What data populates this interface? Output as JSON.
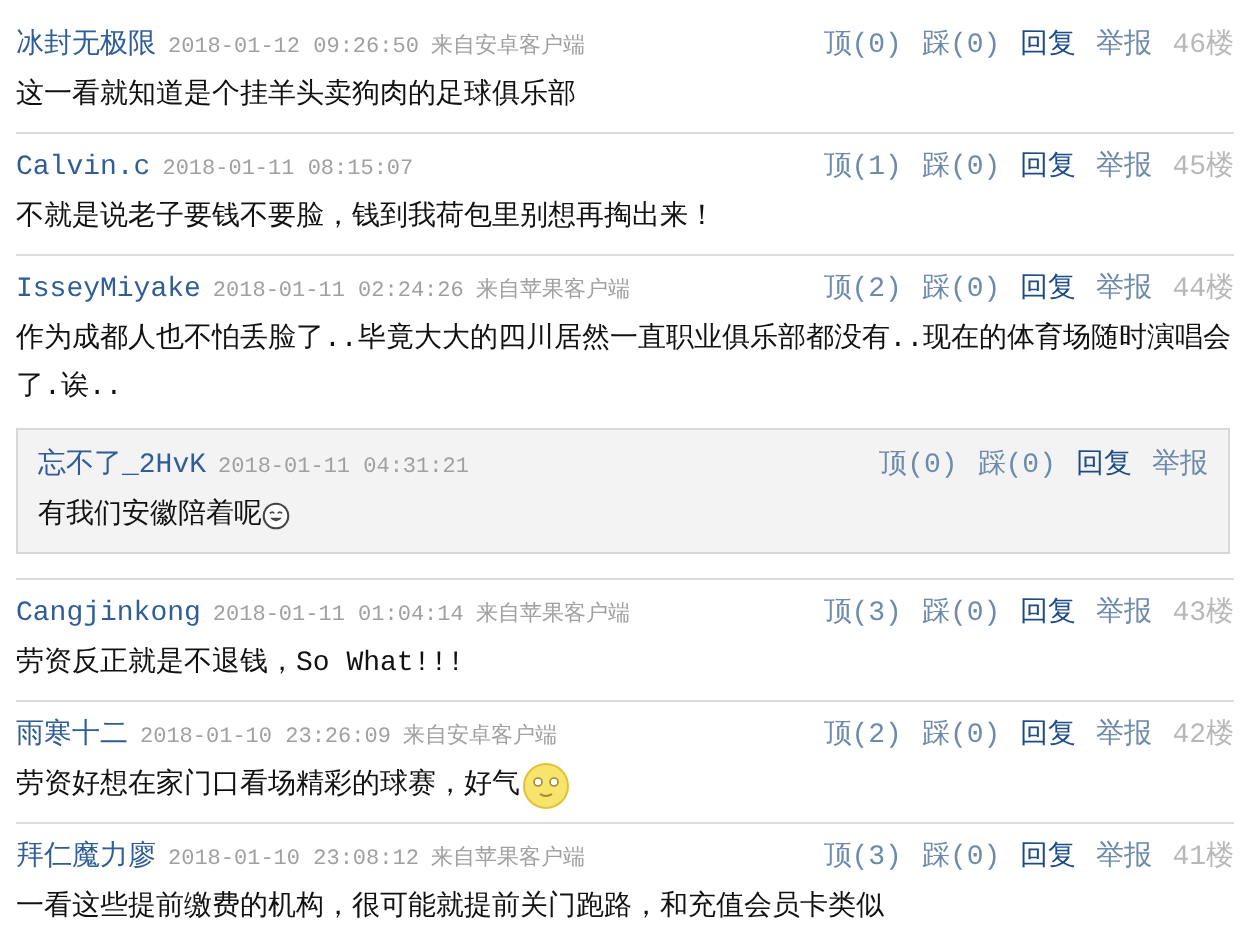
{
  "comments": [
    {
      "user": "冰封无极限",
      "time": "2018-01-12 09:26:50",
      "source": "来自安卓客户端",
      "up": "顶(0)",
      "down": "踩(0)",
      "reply": "回复",
      "report": "举报",
      "floor": "46楼",
      "text": "这一看就知道是个挂羊头卖狗肉的足球俱乐部"
    },
    {
      "user": "Calvin.c",
      "time": "2018-01-11 08:15:07",
      "up": "顶(1)",
      "down": "踩(0)",
      "reply": "回复",
      "report": "举报",
      "floor": "45楼",
      "text": "不就是说老子要钱不要脸，钱到我荷包里别想再掏出来！"
    },
    {
      "user": "IsseyMiyake",
      "time": "2018-01-11 02:24:26",
      "source": "来自苹果客户端",
      "up": "顶(2)",
      "down": "踩(0)",
      "reply": "回复",
      "report": "举报",
      "floor": "44楼",
      "text": "作为成都人也不怕丢脸了..毕竟大大的四川居然一直职业俱乐部都没有..现在的体育场随时演唱会了.诶..",
      "replies": [
        {
          "user": "忘不了_2HvK",
          "time": "2018-01-11 04:31:21",
          "up": "顶(0)",
          "down": "踩(0)",
          "reply": "回复",
          "report": "举报",
          "text": "有我们安徽陪着呢",
          "emoji": {
            "kind": "grin"
          }
        }
      ]
    },
    {
      "user": "Cangjinkong",
      "time": "2018-01-11 01:04:14",
      "source": "来自苹果客户端",
      "up": "顶(3)",
      "down": "踩(0)",
      "reply": "回复",
      "report": "举报",
      "floor": "43楼",
      "text": "劳资反正就是不退钱，So What!!!"
    },
    {
      "user": "雨寒十二",
      "time": "2018-01-10 23:26:09",
      "source": "来自安卓客户端",
      "up": "顶(2)",
      "down": "踩(0)",
      "reply": "回复",
      "report": "举报",
      "floor": "42楼",
      "text": "劳资好想在家门口看场精彩的球赛，好气",
      "emoji": {
        "kind": "smile"
      }
    },
    {
      "user": "拜仁魔力廖",
      "time": "2018-01-10 23:08:12",
      "source": "来自苹果客户端",
      "up": "顶(3)",
      "down": "踩(0)",
      "reply": "回复",
      "report": "举报",
      "floor": "41楼",
      "text": "一看这些提前缴费的机构，很可能就提前关门跑路，和充值会员卡类似"
    }
  ]
}
